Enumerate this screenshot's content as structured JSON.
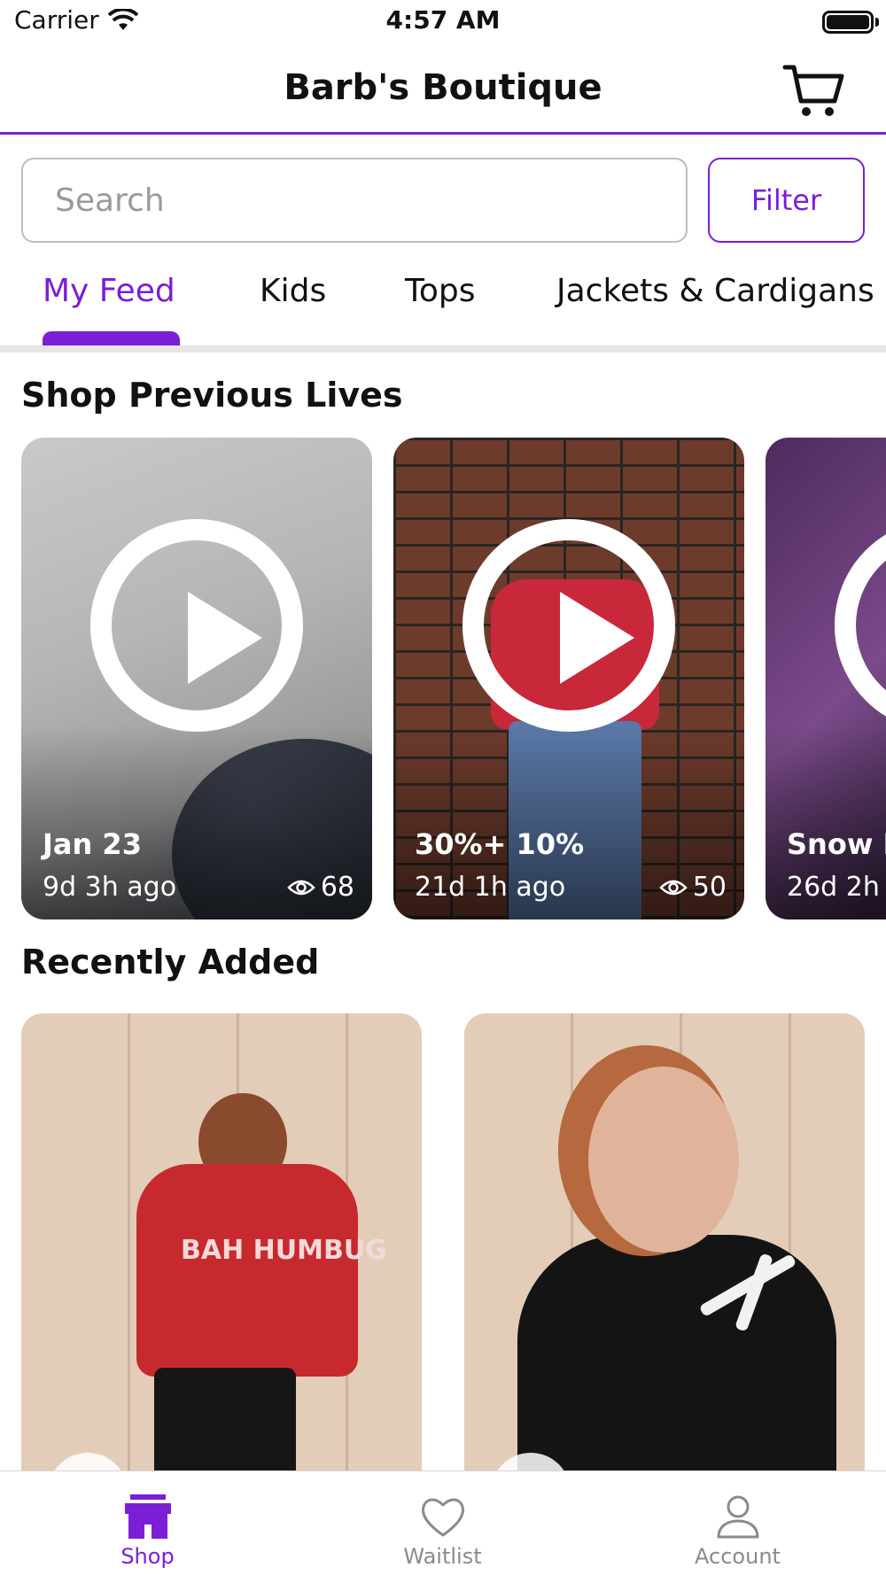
{
  "status_bar": {
    "carrier": "Carrier",
    "time": "4:57 AM"
  },
  "header": {
    "title": "Barb's Boutique",
    "cart_icon": "shopping-cart-icon"
  },
  "search": {
    "placeholder": "Search",
    "value": "",
    "filter_label": "Filter"
  },
  "categories": {
    "selected": "My Feed",
    "items": [
      "My Feed",
      "Kids",
      "Tops",
      "Jackets & Cardigans"
    ]
  },
  "previous_lives": {
    "title": "Shop Previous Lives",
    "items": [
      {
        "title": "Jan 23",
        "ago": "9d 3h ago",
        "views": "68"
      },
      {
        "title": "30%+ 10%",
        "ago": "21d 1h ago",
        "views": "50"
      },
      {
        "title": "Snow D",
        "ago": "26d 2h",
        "views": ""
      }
    ]
  },
  "recently_added": {
    "title": "Recently Added",
    "items": [
      {
        "image_text": "BAH HUMBUG"
      },
      {
        "image_text": ""
      }
    ]
  },
  "tab_bar": {
    "items": [
      {
        "label": "Shop",
        "icon": "storefront-icon",
        "active": true
      },
      {
        "label": "Waitlist",
        "icon": "heart-icon",
        "active": false
      },
      {
        "label": "Account",
        "icon": "person-icon",
        "active": false
      }
    ]
  },
  "colors": {
    "accent": "#7a1fd6",
    "inactive": "#8a8a8a"
  }
}
